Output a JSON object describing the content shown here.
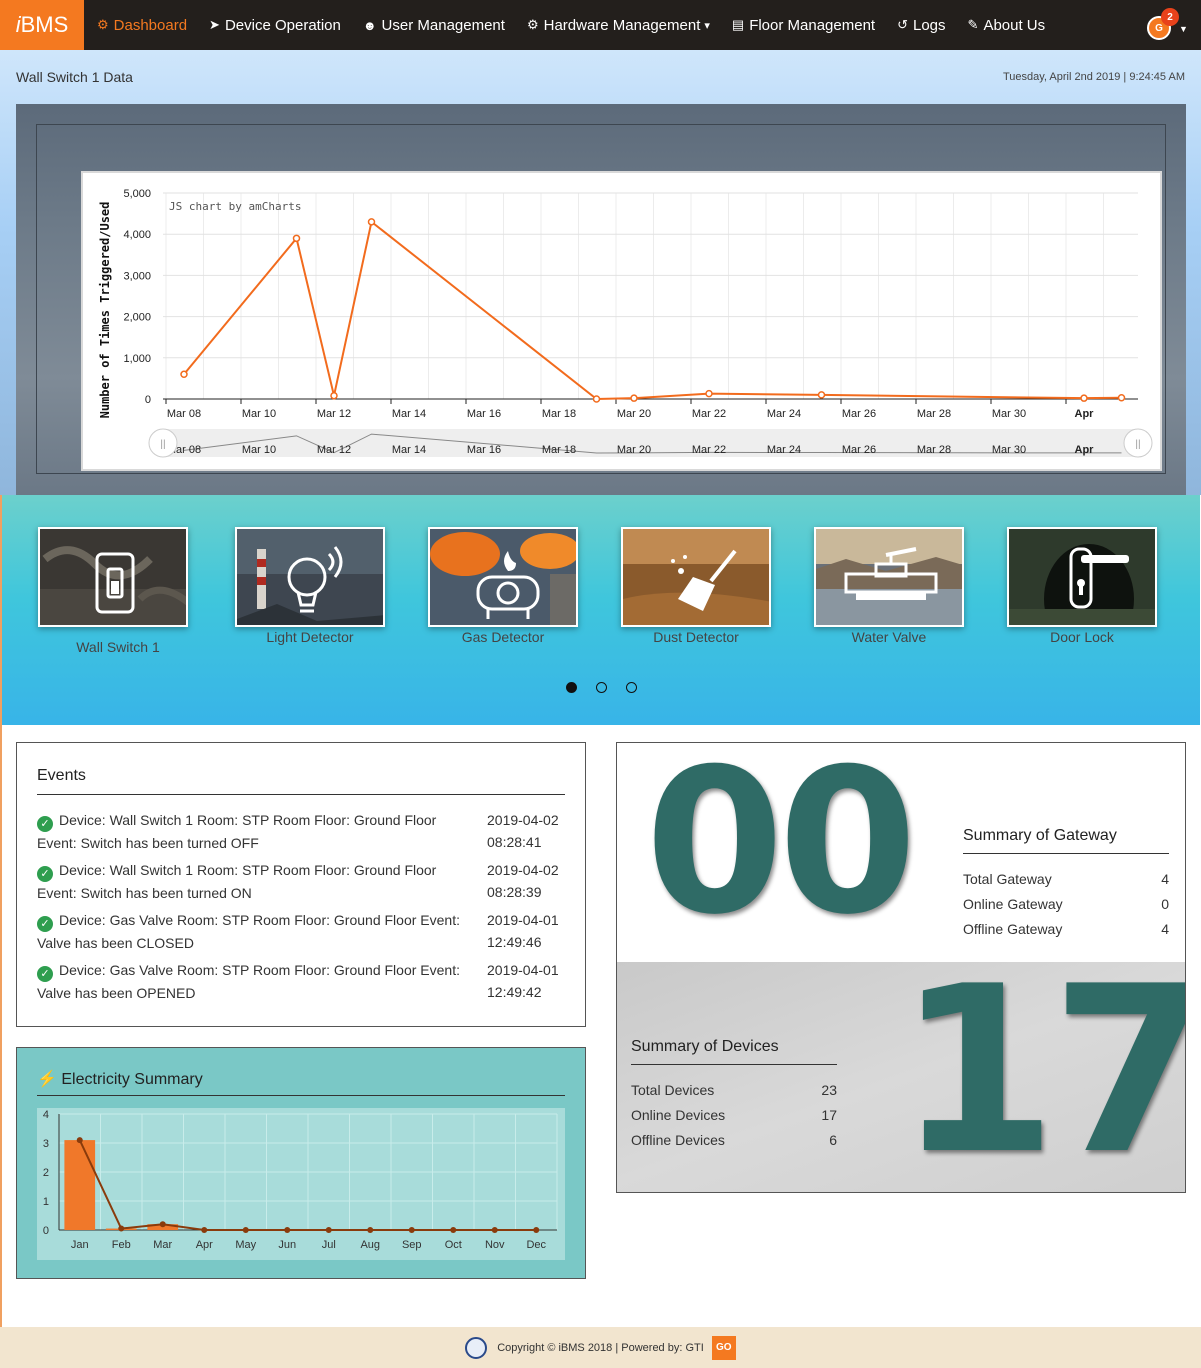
{
  "nav": {
    "brand_i": "i",
    "brand_rest": "BMS",
    "items": [
      {
        "label": "Dashboard",
        "icon": "tachometer-icon",
        "glyph": "⚙"
      },
      {
        "label": "Device Operation",
        "icon": "location-arrow-icon",
        "glyph": "➤"
      },
      {
        "label": "User Management",
        "icon": "users-icon",
        "glyph": "☻"
      },
      {
        "label": "Hardware Management",
        "icon": "cogs-icon",
        "glyph": "⚙"
      },
      {
        "label": "Floor Management",
        "icon": "building-icon",
        "glyph": "▤"
      },
      {
        "label": "Logs",
        "icon": "history-icon",
        "glyph": "↺"
      },
      {
        "label": "About Us",
        "icon": "edit-icon",
        "glyph": "✎"
      }
    ],
    "hardware_caret": "▾",
    "notification_count": "2",
    "avatar_text": "G"
  },
  "header": {
    "title": "Wall Switch 1 Data",
    "datetime": "Tuesday, April 2nd 2019  |  9:24:45 AM"
  },
  "chart_data": {
    "type": "line",
    "credit": "JS chart by amCharts",
    "ylabel": "Number of Times Triggered/Used",
    "ylim": [
      0,
      5000
    ],
    "yticks": [
      "0",
      "1,000",
      "2,000",
      "3,000",
      "4,000",
      "5,000"
    ],
    "xticks": [
      "Mar 08",
      "Mar 10",
      "Mar 12",
      "Mar 14",
      "Mar 16",
      "Mar 18",
      "Mar 20",
      "Mar 22",
      "Mar 24",
      "Mar 26",
      "Mar 28",
      "Mar 30",
      "Apr"
    ],
    "x": [
      "2019-03-08",
      "2019-03-11",
      "2019-03-12",
      "2019-03-13",
      "2019-03-19",
      "2019-03-20",
      "2019-03-22",
      "2019-03-25",
      "2019-04-01",
      "2019-04-02"
    ],
    "values": [
      600,
      3900,
      80,
      4300,
      0,
      20,
      130,
      100,
      20,
      30
    ],
    "color": "#f26b1d"
  },
  "devices": [
    {
      "label": "Wall Switch 1",
      "icon": "light-switch-icon"
    },
    {
      "label": "Light Detector",
      "icon": "lightbulb-icon"
    },
    {
      "label": "Gas Detector",
      "icon": "gas-tank-icon"
    },
    {
      "label": "Dust Detector",
      "icon": "broom-icon"
    },
    {
      "label": "Water Valve",
      "icon": "valve-icon"
    },
    {
      "label": "Door Lock",
      "icon": "door-handle-icon"
    }
  ],
  "carousel_dots": 3,
  "events": {
    "title": "Events",
    "items": [
      {
        "text": "Device: Wall Switch 1 Room: STP Room Floor: Ground Floor Event: Switch has been turned OFF",
        "date": "2019-04-02",
        "time": "08:28:41"
      },
      {
        "text": "Device: Wall Switch 1 Room: STP Room Floor: Ground Floor Event: Switch has been turned ON",
        "date": "2019-04-02",
        "time": "08:28:39"
      },
      {
        "text": "Device: Gas Valve Room: STP Room Floor: Ground Floor Event: Valve has been CLOSED",
        "date": "2019-04-01",
        "time": "12:49:46"
      },
      {
        "text": "Device: Gas Valve Room: STP Room Floor: Ground Floor Event: Valve has been OPENED",
        "date": "2019-04-01",
        "time": "12:49:42"
      }
    ]
  },
  "electricity": {
    "title": "Electricity Summary",
    "chart_data": {
      "type": "bar",
      "categories": [
        "Jan",
        "Feb",
        "Mar",
        "Apr",
        "May",
        "Jun",
        "Jul",
        "Aug",
        "Sep",
        "Oct",
        "Nov",
        "Dec"
      ],
      "values": [
        3.1,
        0.05,
        0.2,
        0,
        0,
        0,
        0,
        0,
        0,
        0,
        0,
        0
      ],
      "ylim": [
        0,
        4
      ],
      "yticks": [
        "0",
        "1",
        "2",
        "3",
        "4"
      ],
      "bar_color": "#f0782a",
      "line_color": "#8a3b0c"
    }
  },
  "gateway": {
    "title": "Summary of Gateway",
    "big_number": "00",
    "rows": [
      {
        "label": "Total Gateway",
        "value": "4"
      },
      {
        "label": "Online Gateway",
        "value": "0"
      },
      {
        "label": "Offline Gateway",
        "value": "4"
      }
    ]
  },
  "devices_summary": {
    "title": "Summary of Devices",
    "big_number": "17",
    "rows": [
      {
        "label": "Total Devices",
        "value": "23"
      },
      {
        "label": "Online Devices",
        "value": "17"
      },
      {
        "label": "Offline Devices",
        "value": "6"
      }
    ]
  },
  "footer": {
    "text": "Copyright © iBMS 2018 | Powered by: GTI",
    "logo2_text": "GO"
  }
}
